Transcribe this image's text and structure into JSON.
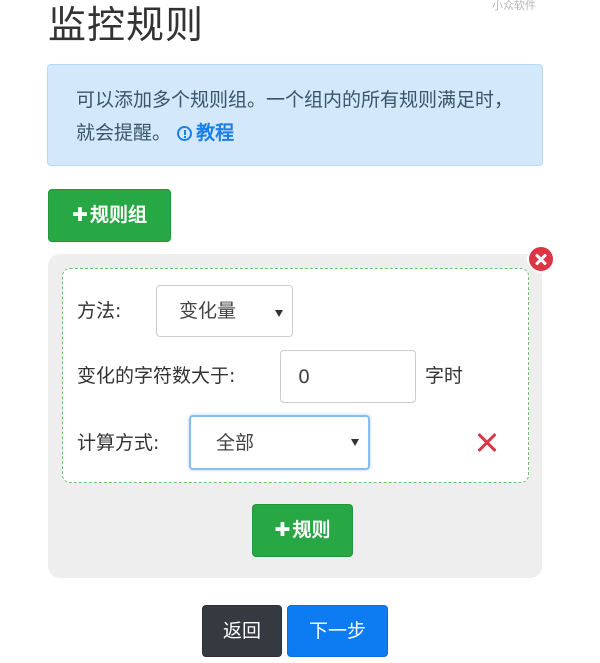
{
  "watermark": "小众软件",
  "page": {
    "title": "监控规则"
  },
  "info": {
    "text": "可以添加多个规则组。一个组内的所有规则满足时，就会提醒。",
    "tutorial_label": "教程",
    "tutorial_icon": "info-circle-icon"
  },
  "buttons": {
    "add_group_icon": "✚",
    "add_group_label": "规则组",
    "add_rule_icon": "✚",
    "add_rule_label": "规则",
    "back_label": "返回",
    "next_label": "下一步"
  },
  "rule": {
    "method_label": "方法:",
    "method_value": "变化量",
    "char_count_label": "变化的字符数大于:",
    "char_count_value": "0",
    "char_count_suffix": "字时",
    "calc_label": "计算方式:",
    "calc_value": "全部"
  },
  "colors": {
    "success": "#28a745",
    "primary": "#0d7cf2",
    "dark": "#343a40",
    "danger": "#dc3545",
    "info_bg": "#d4e8fc",
    "group_bg": "#eeeeee",
    "rule_border": "#6fbf6f"
  }
}
